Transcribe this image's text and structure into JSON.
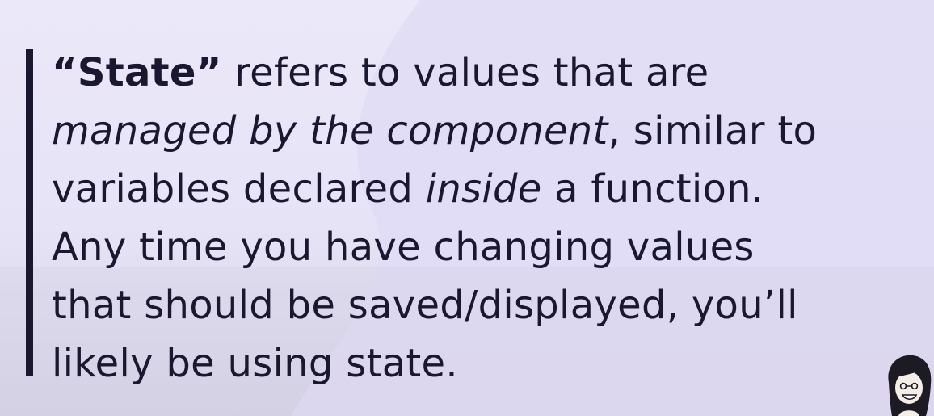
{
  "slide": {
    "quote": {
      "line1": {
        "term": "“State”",
        "rest": " refers to values that are"
      },
      "line2": {
        "emphasis": "managed by the component",
        "rest": ", similar to"
      },
      "line3": {
        "before": "variables declared ",
        "emphasis": "inside",
        "after": " a function."
      },
      "line4": "Any time you have changing values",
      "line5": "that should be saved/displayed, you’ll",
      "line6": "likely be using state."
    },
    "avatar_icon": "presenter-avatar",
    "colors": {
      "background": "#e9e6f8",
      "background_shape": "#e1dcf6",
      "text": "#1a1830",
      "bar": "#1a1830"
    }
  }
}
